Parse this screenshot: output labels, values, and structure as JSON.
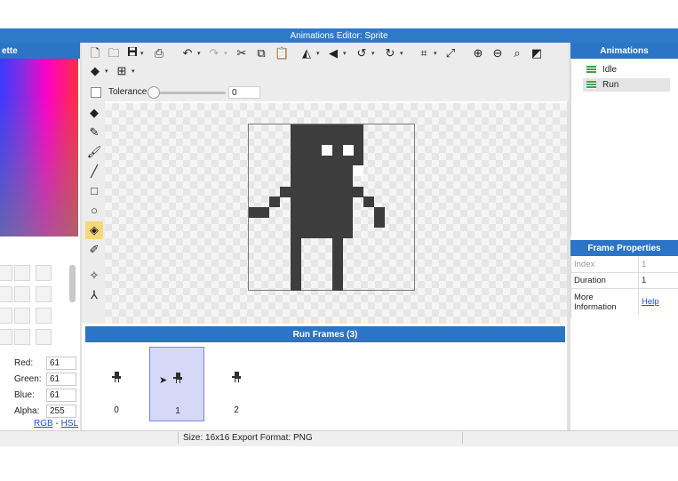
{
  "window": {
    "title": "Animations Editor: Sprite"
  },
  "palette": {
    "header": "ette",
    "red_label": "Red:",
    "red_value": "61",
    "green_label": "Green:",
    "green_value": "61",
    "blue_label": "Blue:",
    "blue_value": "61",
    "alpha_label": "Alpha:",
    "alpha_value": "255",
    "mode_rgb": "RGB",
    "mode_sep": " - ",
    "mode_hsl": "HSL"
  },
  "toolbar": {
    "icons": [
      "new-file-icon",
      "open-folder-icon",
      "save-icon",
      "export-icon",
      "undo-icon",
      "redo-icon",
      "cut-icon",
      "copy-icon",
      "paste-icon",
      "flip-horizontal-icon",
      "flip-vertical-icon",
      "rotate-left-icon",
      "rotate-right-icon",
      "crop-icon",
      "resize-icon",
      "zoom-in-icon",
      "zoom-out-icon",
      "zoom-fit-icon",
      "toggle-grid-icon",
      "layers-icon",
      "grid-icon"
    ],
    "tolerance_label": "Tolerance",
    "tolerance_value": "0"
  },
  "tools": [
    "eraser-icon",
    "pencil-icon",
    "brush-icon",
    "line-icon",
    "rectangle-icon",
    "ellipse-icon",
    "fill-bucket-icon",
    "eyedropper-icon",
    "move-point-icon",
    "node-icon"
  ],
  "animations": {
    "header": "Animations",
    "items": [
      {
        "label": "Idle"
      },
      {
        "label": "Run"
      }
    ],
    "selected": "Run",
    "accent_color": "#3da34a"
  },
  "frame_properties": {
    "header": "Frame Properties",
    "rows": [
      {
        "key": "Index",
        "value": "1"
      },
      {
        "key": "Duration",
        "value": "1"
      },
      {
        "key": "More Information",
        "value": "Help"
      }
    ]
  },
  "frames": {
    "header": "Run Frames (3)",
    "items": [
      {
        "label": "0"
      },
      {
        "label": "1"
      },
      {
        "label": "2"
      }
    ],
    "selected_index": 1
  },
  "status": {
    "text": "Size: 16x16   Export Format: PNG"
  },
  "colors": {
    "header_blue": "#2b74c6",
    "sprite_color": "#3d3d3d",
    "selection_fill": "#d6d8f7"
  }
}
